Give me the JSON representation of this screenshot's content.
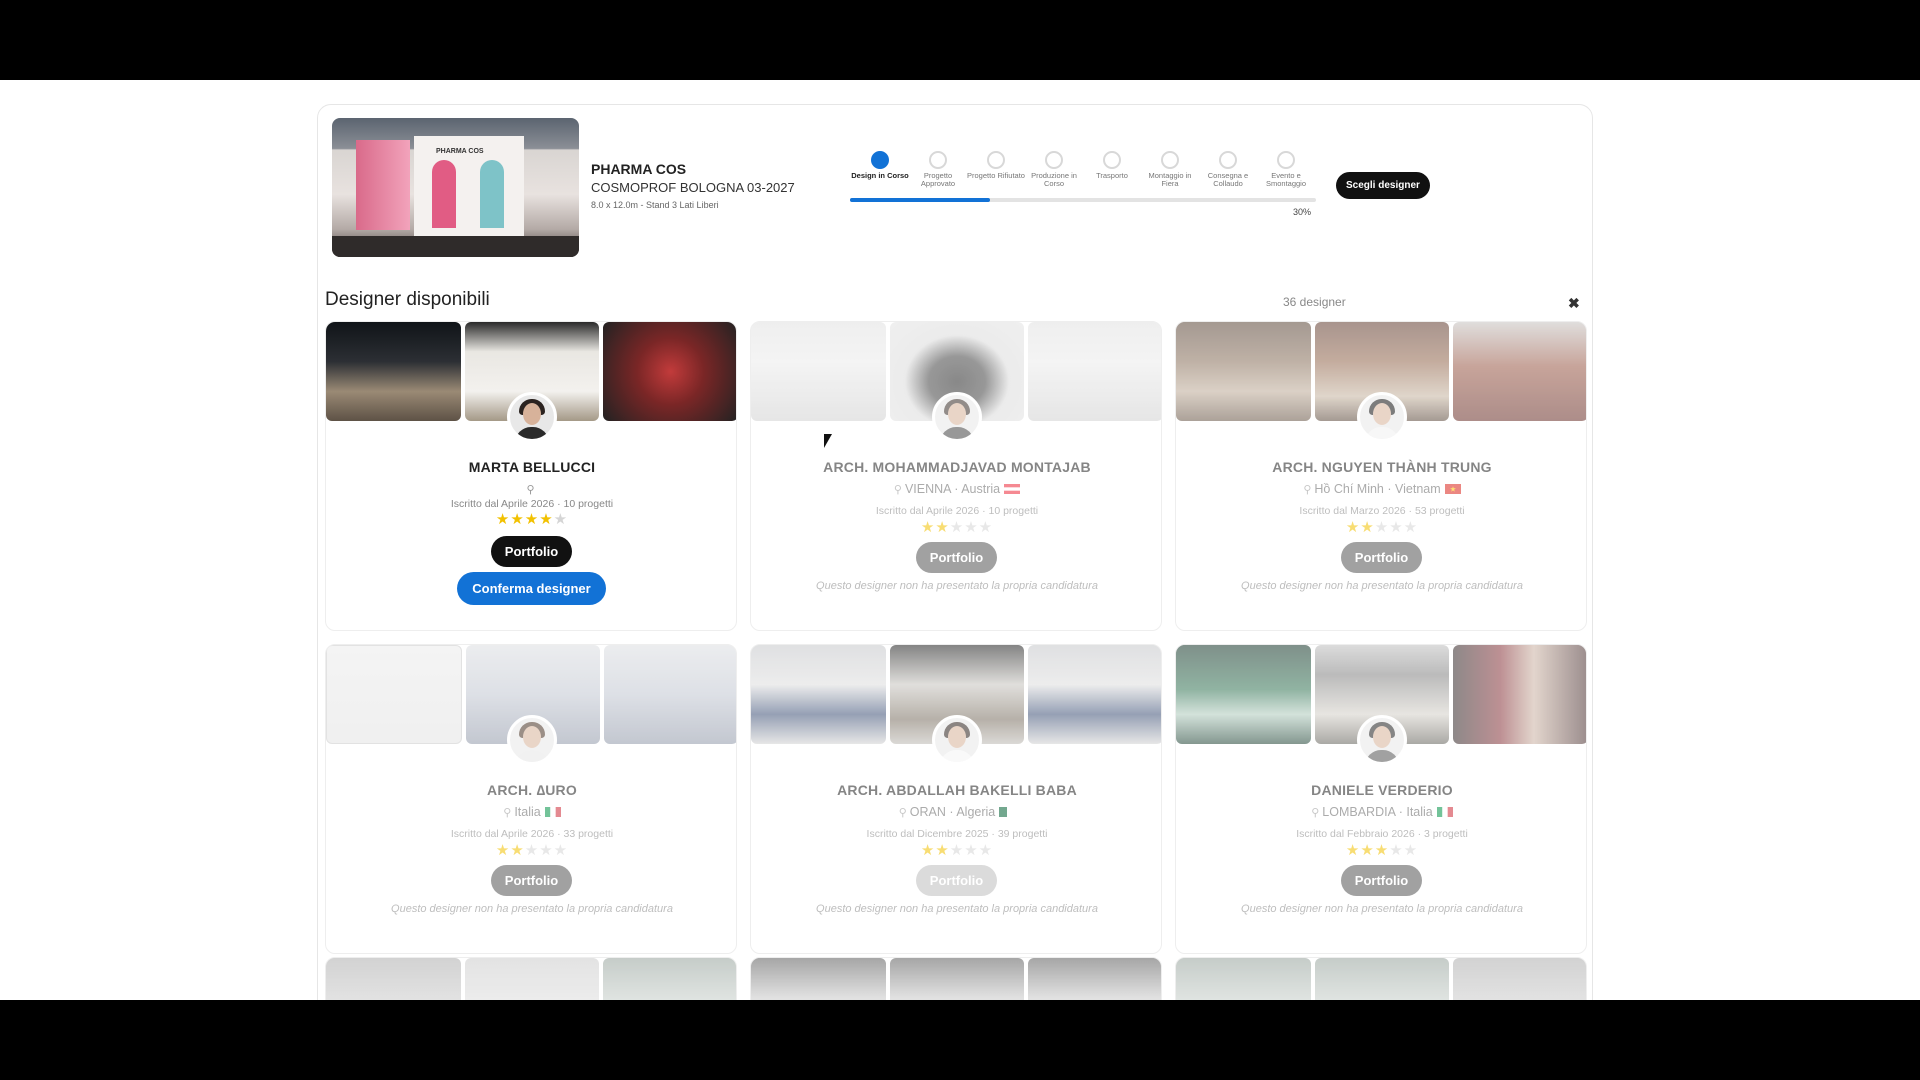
{
  "project": {
    "name": "PHARMA COS",
    "event": "COSMOPROF BOLOGNA 03-2027",
    "meta": "8.0 x 12.0m - Stand 3 Lati Liberi",
    "thumb_sign": "PHARMA COS"
  },
  "steps": [
    {
      "label": "Design in Corso",
      "active": true
    },
    {
      "label": "Progetto Approvato",
      "active": false
    },
    {
      "label": "Progetto Rifiutato",
      "active": false
    },
    {
      "label": "Produzione in Corso",
      "active": false
    },
    {
      "label": "Trasporto",
      "active": false
    },
    {
      "label": "Montaggio in Fiera",
      "active": false
    },
    {
      "label": "Consegna e Collaudo",
      "active": false
    },
    {
      "label": "Evento e Smontaggio",
      "active": false
    }
  ],
  "progress": {
    "value": 0.3,
    "label": "30%"
  },
  "header": {
    "choose_designer_label": "Scegli designer"
  },
  "section": {
    "title": "Designer disponibili",
    "count": "36 designer",
    "close_icon": "close-icon"
  },
  "colors": {
    "accent": "#1272d6",
    "star": "#f2c100",
    "dark_button": "#111111"
  },
  "designers": [
    {
      "name": "MARTA BELLUCCI",
      "city": "",
      "country": "",
      "flag": "",
      "meta": "Iscritto dal Aprile 2026 · 10 progetti",
      "rating": 4,
      "portfolio": "Portfolio",
      "confirm": "Conferma designer",
      "note": ""
    },
    {
      "name": "ARCH. MOHAMMADJAVAD MONTAJAB",
      "city": "VIENNA",
      "country": "Austria",
      "flag": "austria",
      "meta": "Iscritto dal Aprile 2026 · 10 progetti",
      "rating": 2,
      "portfolio": "Portfolio",
      "confirm": "",
      "note": "Questo designer non ha presentato la propria candidatura"
    },
    {
      "name": "ARCH. NGUYEN THÀNH TRUNG",
      "city": "Hồ Chí Minh",
      "country": "Vietnam",
      "flag": "vietnam",
      "meta": "Iscritto dal Marzo 2026 · 53 progetti",
      "rating": 2,
      "portfolio": "Portfolio",
      "confirm": "",
      "note": "Questo designer non ha presentato la propria candidatura"
    },
    {
      "name": "ARCH. ∆URO",
      "city": "Italia",
      "country": "",
      "flag": "italy",
      "meta": "Iscritto dal Aprile 2026 · 33 progetti",
      "rating": 2,
      "portfolio": "Portfolio",
      "confirm": "",
      "note": "Questo designer non ha presentato la propria candidatura"
    },
    {
      "name": "ARCH. ABDALLAH BAKELLI BABA",
      "city": "ORAN",
      "country": "Algeria",
      "flag": "algeria",
      "meta": "Iscritto dal Dicembre 2025 · 39 progetti",
      "rating": 2,
      "portfolio": "Portfolio",
      "confirm": "",
      "note": "Questo designer non ha presentato la propria candidatura"
    },
    {
      "name": "DANIELE VERDERIO",
      "city": "LOMBARDIA",
      "country": "Italia",
      "flag": "italy",
      "meta": "Iscritto dal Febbraio 2026 · 3 progetti",
      "rating": 3,
      "portfolio": "Portfolio",
      "confirm": "",
      "note": "Questo designer non ha presentato la propria candidatura"
    }
  ]
}
